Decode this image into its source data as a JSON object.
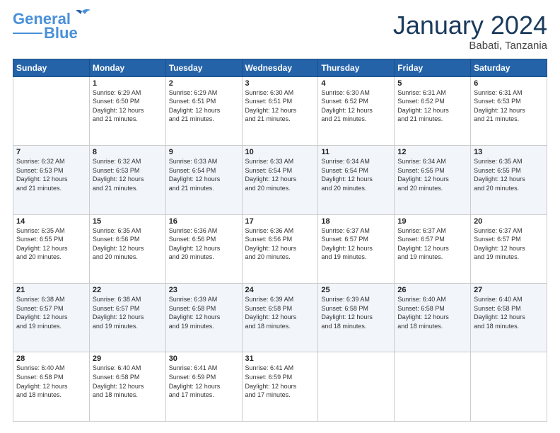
{
  "header": {
    "logo_line1": "General",
    "logo_line2": "Blue",
    "month": "January 2024",
    "location": "Babati, Tanzania"
  },
  "weekdays": [
    "Sunday",
    "Monday",
    "Tuesday",
    "Wednesday",
    "Thursday",
    "Friday",
    "Saturday"
  ],
  "weeks": [
    [
      {
        "day": "",
        "content": ""
      },
      {
        "day": "1",
        "content": "Sunrise: 6:29 AM\nSunset: 6:50 PM\nDaylight: 12 hours\nand 21 minutes."
      },
      {
        "day": "2",
        "content": "Sunrise: 6:29 AM\nSunset: 6:51 PM\nDaylight: 12 hours\nand 21 minutes."
      },
      {
        "day": "3",
        "content": "Sunrise: 6:30 AM\nSunset: 6:51 PM\nDaylight: 12 hours\nand 21 minutes."
      },
      {
        "day": "4",
        "content": "Sunrise: 6:30 AM\nSunset: 6:52 PM\nDaylight: 12 hours\nand 21 minutes."
      },
      {
        "day": "5",
        "content": "Sunrise: 6:31 AM\nSunset: 6:52 PM\nDaylight: 12 hours\nand 21 minutes."
      },
      {
        "day": "6",
        "content": "Sunrise: 6:31 AM\nSunset: 6:53 PM\nDaylight: 12 hours\nand 21 minutes."
      }
    ],
    [
      {
        "day": "7",
        "content": "Sunrise: 6:32 AM\nSunset: 6:53 PM\nDaylight: 12 hours\nand 21 minutes."
      },
      {
        "day": "8",
        "content": "Sunrise: 6:32 AM\nSunset: 6:53 PM\nDaylight: 12 hours\nand 21 minutes."
      },
      {
        "day": "9",
        "content": "Sunrise: 6:33 AM\nSunset: 6:54 PM\nDaylight: 12 hours\nand 21 minutes."
      },
      {
        "day": "10",
        "content": "Sunrise: 6:33 AM\nSunset: 6:54 PM\nDaylight: 12 hours\nand 20 minutes."
      },
      {
        "day": "11",
        "content": "Sunrise: 6:34 AM\nSunset: 6:54 PM\nDaylight: 12 hours\nand 20 minutes."
      },
      {
        "day": "12",
        "content": "Sunrise: 6:34 AM\nSunset: 6:55 PM\nDaylight: 12 hours\nand 20 minutes."
      },
      {
        "day": "13",
        "content": "Sunrise: 6:35 AM\nSunset: 6:55 PM\nDaylight: 12 hours\nand 20 minutes."
      }
    ],
    [
      {
        "day": "14",
        "content": "Sunrise: 6:35 AM\nSunset: 6:55 PM\nDaylight: 12 hours\nand 20 minutes."
      },
      {
        "day": "15",
        "content": "Sunrise: 6:35 AM\nSunset: 6:56 PM\nDaylight: 12 hours\nand 20 minutes."
      },
      {
        "day": "16",
        "content": "Sunrise: 6:36 AM\nSunset: 6:56 PM\nDaylight: 12 hours\nand 20 minutes."
      },
      {
        "day": "17",
        "content": "Sunrise: 6:36 AM\nSunset: 6:56 PM\nDaylight: 12 hours\nand 20 minutes."
      },
      {
        "day": "18",
        "content": "Sunrise: 6:37 AM\nSunset: 6:57 PM\nDaylight: 12 hours\nand 19 minutes."
      },
      {
        "day": "19",
        "content": "Sunrise: 6:37 AM\nSunset: 6:57 PM\nDaylight: 12 hours\nand 19 minutes."
      },
      {
        "day": "20",
        "content": "Sunrise: 6:37 AM\nSunset: 6:57 PM\nDaylight: 12 hours\nand 19 minutes."
      }
    ],
    [
      {
        "day": "21",
        "content": "Sunrise: 6:38 AM\nSunset: 6:57 PM\nDaylight: 12 hours\nand 19 minutes."
      },
      {
        "day": "22",
        "content": "Sunrise: 6:38 AM\nSunset: 6:57 PM\nDaylight: 12 hours\nand 19 minutes."
      },
      {
        "day": "23",
        "content": "Sunrise: 6:39 AM\nSunset: 6:58 PM\nDaylight: 12 hours\nand 19 minutes."
      },
      {
        "day": "24",
        "content": "Sunrise: 6:39 AM\nSunset: 6:58 PM\nDaylight: 12 hours\nand 18 minutes."
      },
      {
        "day": "25",
        "content": "Sunrise: 6:39 AM\nSunset: 6:58 PM\nDaylight: 12 hours\nand 18 minutes."
      },
      {
        "day": "26",
        "content": "Sunrise: 6:40 AM\nSunset: 6:58 PM\nDaylight: 12 hours\nand 18 minutes."
      },
      {
        "day": "27",
        "content": "Sunrise: 6:40 AM\nSunset: 6:58 PM\nDaylight: 12 hours\nand 18 minutes."
      }
    ],
    [
      {
        "day": "28",
        "content": "Sunrise: 6:40 AM\nSunset: 6:58 PM\nDaylight: 12 hours\nand 18 minutes."
      },
      {
        "day": "29",
        "content": "Sunrise: 6:40 AM\nSunset: 6:58 PM\nDaylight: 12 hours\nand 18 minutes."
      },
      {
        "day": "30",
        "content": "Sunrise: 6:41 AM\nSunset: 6:59 PM\nDaylight: 12 hours\nand 17 minutes."
      },
      {
        "day": "31",
        "content": "Sunrise: 6:41 AM\nSunset: 6:59 PM\nDaylight: 12 hours\nand 17 minutes."
      },
      {
        "day": "",
        "content": ""
      },
      {
        "day": "",
        "content": ""
      },
      {
        "day": "",
        "content": ""
      }
    ]
  ]
}
